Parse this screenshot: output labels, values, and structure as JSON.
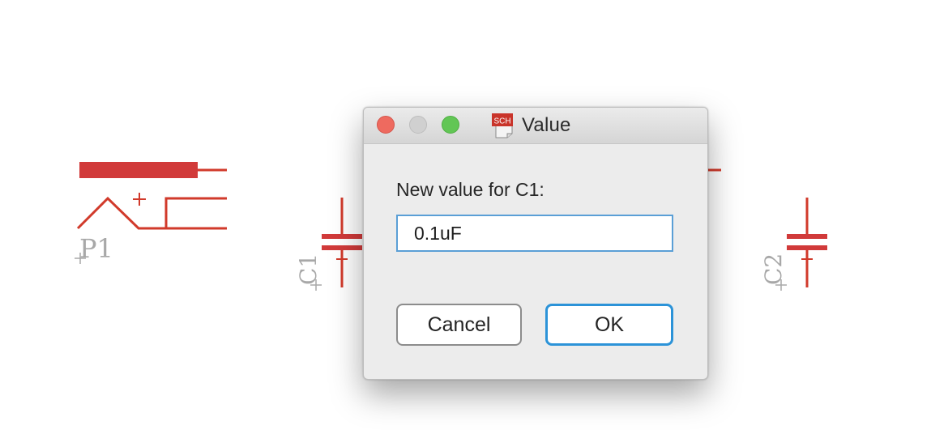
{
  "dialog": {
    "title": "Value",
    "app_icon_text": "SCH",
    "prompt": "New value for C1:",
    "value": "0.1uF",
    "cancel_label": "Cancel",
    "ok_label": "OK"
  },
  "schematic": {
    "components": [
      {
        "ref": "P1"
      },
      {
        "ref": "C1"
      },
      {
        "ref": "C2"
      }
    ],
    "wire_color": "#d13a2b",
    "pad_color": "#d13a3a",
    "label_color": "#a8a8a8"
  }
}
